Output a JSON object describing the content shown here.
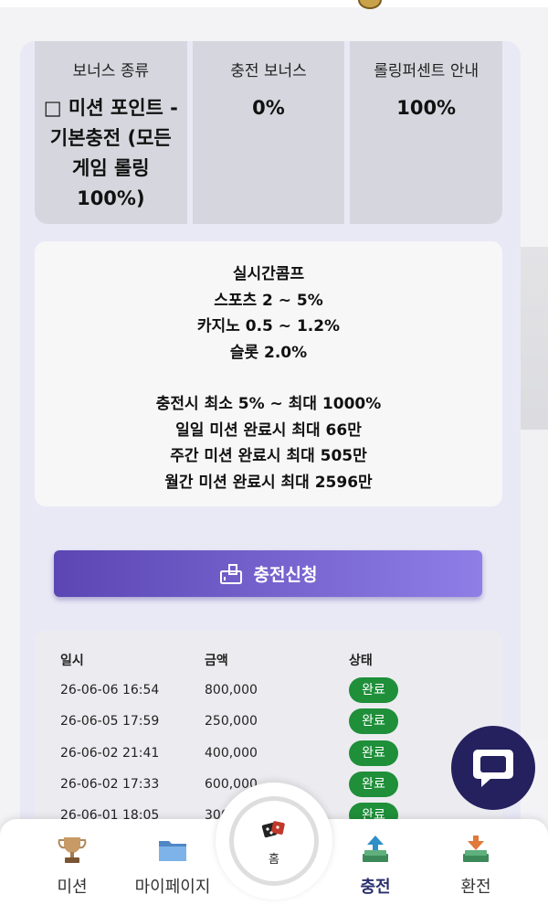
{
  "bonus_table": {
    "headers": [
      "보너스 종류",
      "충전 보너스",
      "롤링퍼센트 안내"
    ],
    "values": [
      "□ 미션 포인트 - 기본충전 (모든게임 롤링 100%)",
      "0%",
      "100%"
    ]
  },
  "info": {
    "comp_lines": [
      "실시간콤프",
      "스포츠 2 ~ 5%",
      "카지노 0.5 ~ 1.2%",
      "슬롯 2.0%"
    ],
    "mission_lines": [
      "충전시 최소 5% ~ 최대 1000%",
      "일일 미션 완료시 최대 66만",
      "주간 미션 완료시 최대 505만",
      "월간 미션 완료시 최대 2596만"
    ]
  },
  "apply_button": {
    "label": "충전신청"
  },
  "history": {
    "columns": [
      "일시",
      "금액",
      "상태"
    ],
    "rows": [
      {
        "date": "26-06-06 16:54",
        "amount": "800,000",
        "status": "완료"
      },
      {
        "date": "26-06-05 17:59",
        "amount": "250,000",
        "status": "완료"
      },
      {
        "date": "26-06-02 21:41",
        "amount": "400,000",
        "status": "완료"
      },
      {
        "date": "26-06-02 17:33",
        "amount": "600,000",
        "status": "완료"
      },
      {
        "date": "26-06-01 18:05",
        "amount": "300",
        "status": "완료"
      }
    ]
  },
  "bottom_nav": {
    "items": [
      {
        "label": "미션",
        "icon": "trophy-icon"
      },
      {
        "label": "마이페이지",
        "icon": "folder-icon"
      },
      {
        "label": "홈",
        "icon": "home-dice-icon"
      },
      {
        "label": "충전",
        "icon": "deposit-icon"
      },
      {
        "label": "환전",
        "icon": "withdraw-icon"
      }
    ],
    "active": "충전"
  },
  "colors": {
    "accent_start": "#5b46b3",
    "accent_end": "#8f7ee6",
    "status_green": "#1f8f3a",
    "chat_navy": "#25205e"
  }
}
